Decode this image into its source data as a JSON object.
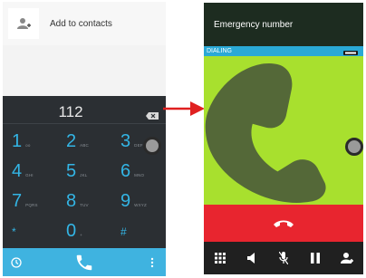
{
  "dialer": {
    "add_contacts_label": "Add to contacts",
    "number": "112",
    "keys": [
      {
        "digit": "1",
        "letters": "oo"
      },
      {
        "digit": "2",
        "letters": "ABC"
      },
      {
        "digit": "3",
        "letters": "DEF"
      },
      {
        "digit": "4",
        "letters": "GHI"
      },
      {
        "digit": "5",
        "letters": "JKL"
      },
      {
        "digit": "6",
        "letters": "MNO"
      },
      {
        "digit": "7",
        "letters": "PQRS"
      },
      {
        "digit": "8",
        "letters": "TUV"
      },
      {
        "digit": "9",
        "letters": "WXYZ"
      },
      {
        "digit": "*",
        "letters": ""
      },
      {
        "digit": "0",
        "letters": "+"
      },
      {
        "digit": "#",
        "letters": ""
      }
    ],
    "icons": {
      "add_contact": "add-contact-icon",
      "backspace": "backspace-icon",
      "history": "clock-icon",
      "call": "phone-icon",
      "menu": "overflow-menu-icon"
    },
    "colors": {
      "panel": "#2b2f33",
      "digit": "#33b5e5",
      "bar": "#3fb3e0"
    }
  },
  "calling": {
    "name": "Emergency number",
    "status": "DIALING",
    "controls": [
      "dialpad-icon",
      "speaker-icon",
      "mute-icon",
      "hold-icon",
      "add-call-icon"
    ],
    "colors": {
      "header": "#1d2c20",
      "status": "#2aa9d6",
      "background": "#a8e02e",
      "hangup": "#e8252f",
      "controls": "#202020"
    }
  },
  "arrow_color": "#e02020"
}
